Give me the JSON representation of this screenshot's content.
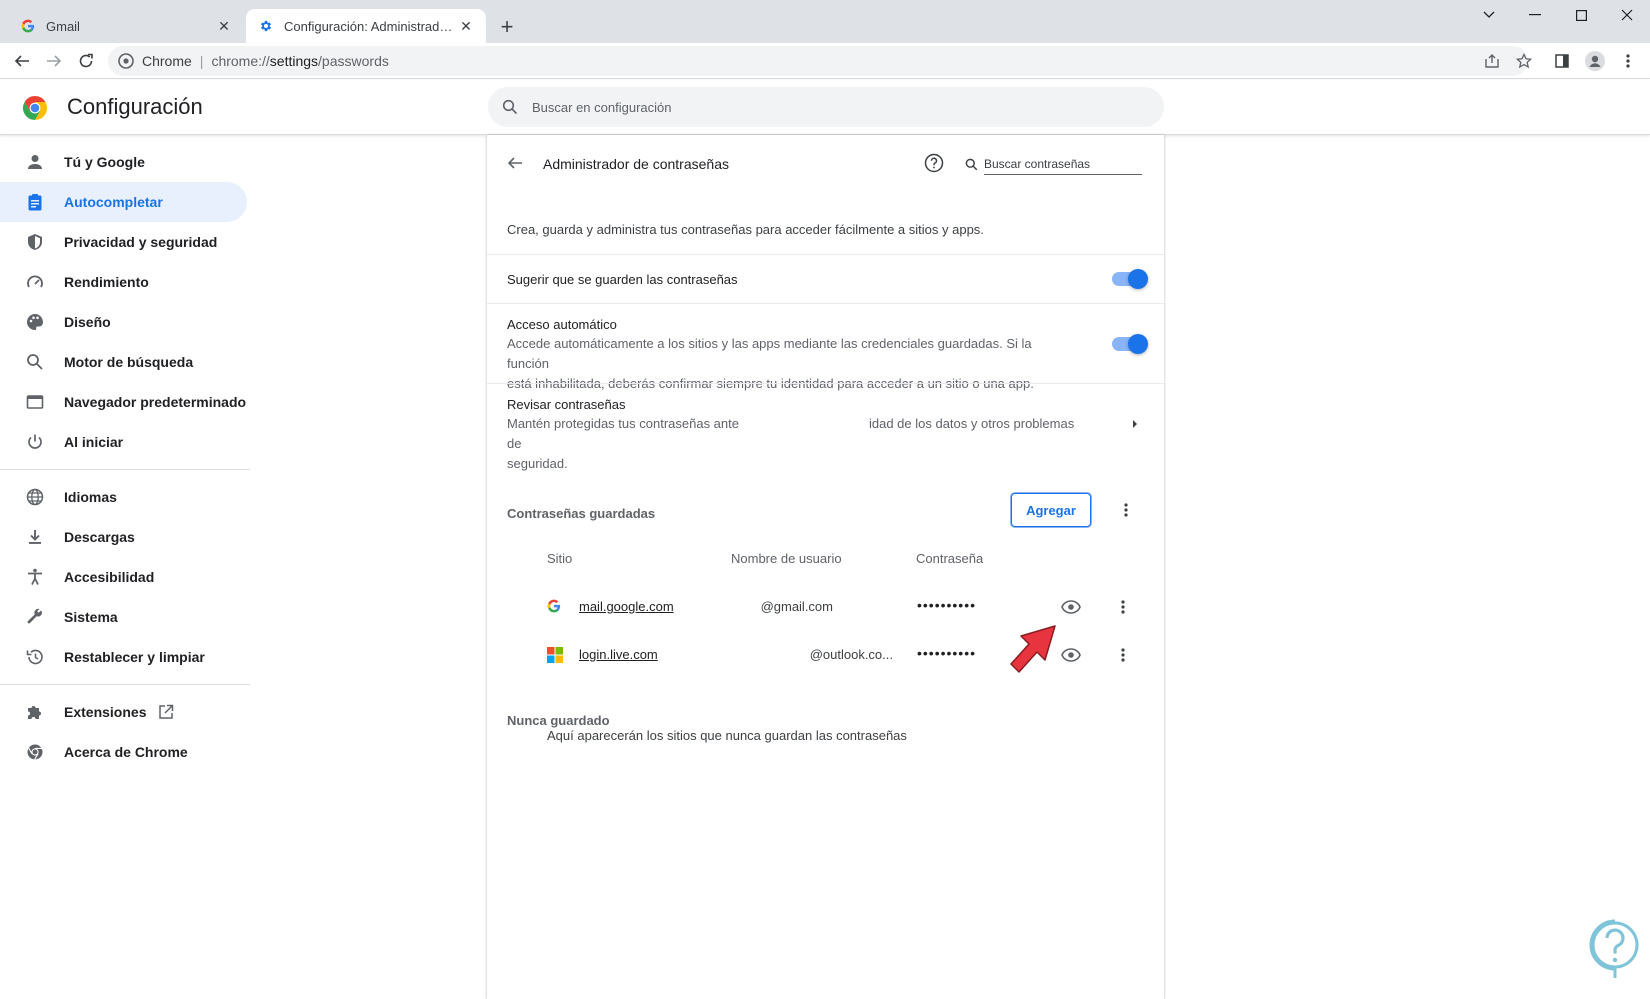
{
  "tabs": [
    {
      "title": "Gmail",
      "icon": "google-g-icon",
      "active": false
    },
    {
      "title": "Configuración: Administrador de",
      "icon": "gear-icon",
      "active": true
    }
  ],
  "toolbar": {
    "site_label": "Chrome",
    "url_scheme": "chrome://",
    "url_host": "settings",
    "url_path": "/passwords"
  },
  "settings": {
    "title": "Configuración",
    "search_placeholder": "Buscar en configuración"
  },
  "sidebar": {
    "items": [
      {
        "label": "Tú y Google",
        "icon": "person-icon"
      },
      {
        "label": "Autocompletar",
        "icon": "clipboard-icon",
        "selected": true
      },
      {
        "label": "Privacidad y seguridad",
        "icon": "shield-icon"
      },
      {
        "label": "Rendimiento",
        "icon": "speedometer-icon"
      },
      {
        "label": "Diseño",
        "icon": "palette-icon"
      },
      {
        "label": "Motor de búsqueda",
        "icon": "search-icon"
      },
      {
        "label": "Navegador predeterminado",
        "icon": "browser-window-icon"
      },
      {
        "label": "Al iniciar",
        "icon": "power-icon"
      }
    ],
    "items2": [
      {
        "label": "Idiomas",
        "icon": "globe-icon"
      },
      {
        "label": "Descargas",
        "icon": "download-icon"
      },
      {
        "label": "Accesibilidad",
        "icon": "accessibility-icon"
      },
      {
        "label": "Sistema",
        "icon": "wrench-icon"
      },
      {
        "label": "Restablecer y limpiar",
        "icon": "history-icon"
      }
    ],
    "items3": [
      {
        "label": "Extensiones",
        "icon": "puzzle-icon"
      },
      {
        "label": "Acerca de Chrome",
        "icon": "chrome-icon"
      }
    ]
  },
  "passwords": {
    "header_title": "Administrador de contraseñas",
    "search_placeholder": "Buscar contraseñas",
    "description": "Crea, guarda y administra tus contraseñas para acceder fácilmente a sitios y apps.",
    "offer_save_label": "Sugerir que se guarden las contraseñas",
    "offer_save_on": true,
    "auto_signin_label": "Acceso automático",
    "auto_signin_desc_1": "Accede automáticamente a los sitios y las apps mediante las credenciales guardadas. Si la función",
    "auto_signin_desc_2": "está inhabilitada, deberás confirmar siempre tu identidad para acceder a un sitio o una app.",
    "auto_signin_on": true,
    "check_label": "Revisar contraseñas",
    "check_desc_left": "Mantén protegidas tus contraseñas ante",
    "check_desc_right": "idad de los datos y otros problemas de",
    "check_desc_2": "seguridad.",
    "saved_title": "Contraseñas guardadas",
    "add_label": "Agregar",
    "col_site": "Sitio",
    "col_user": "Nombre de usuario",
    "col_password": "Contraseña",
    "entries": [
      {
        "site": "mail.google.com",
        "username": "@gmail.com",
        "password": "••••••••••",
        "favicon": "google-g-icon"
      },
      {
        "site": "login.live.com",
        "username": "@outlook.co...",
        "password": "••••••••••",
        "favicon": "microsoft-icon"
      }
    ],
    "never_title": "Nunca guardado",
    "never_empty": "Aquí aparecerán los sitios que nunca guardan las contraseñas"
  },
  "colors": {
    "accent": "#1a73e8",
    "selected_bg": "#e8f0fe",
    "annotation_arrow": "#e8343f"
  }
}
